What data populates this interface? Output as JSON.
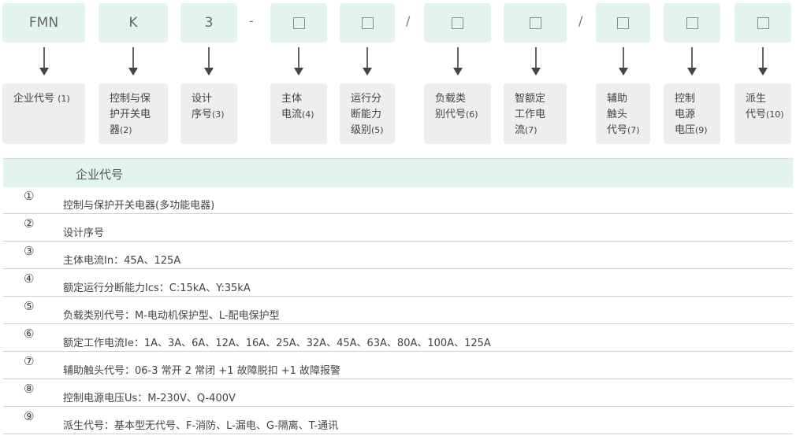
{
  "codes": [
    {
      "text": "FMN",
      "placeholder": false
    },
    {
      "text": "K",
      "placeholder": false
    },
    {
      "text": "3",
      "placeholder": false
    },
    {
      "text": "",
      "placeholder": true
    },
    {
      "text": "",
      "placeholder": true
    },
    {
      "text": "",
      "placeholder": true
    },
    {
      "text": "",
      "placeholder": true
    },
    {
      "text": "",
      "placeholder": true
    },
    {
      "text": "",
      "placeholder": true
    },
    {
      "text": "",
      "placeholder": true
    }
  ],
  "separators": [
    "-",
    "/",
    "/"
  ],
  "descriptions": [
    {
      "lines": [
        {
          "text": "企业代号",
          "num": "(1)"
        }
      ]
    },
    {
      "lines": [
        {
          "text": "控制与保"
        },
        {
          "text": "护开关电"
        },
        {
          "text": "器",
          "num": "(2)"
        }
      ]
    },
    {
      "lines": [
        {
          "text": "设计"
        },
        {
          "text": "序号",
          "num": "(3)"
        }
      ]
    },
    {
      "lines": [
        {
          "text": "主体"
        },
        {
          "text": "电流",
          "num": "(4)"
        }
      ]
    },
    {
      "lines": [
        {
          "text": "运行分"
        },
        {
          "text": "断能力"
        },
        {
          "text": "级别",
          "num": "(5)"
        }
      ]
    },
    {
      "lines": [
        {
          "text": "负载类"
        },
        {
          "text": "别代号",
          "num": "(6)"
        }
      ]
    },
    {
      "lines": [
        {
          "text": "智额定"
        },
        {
          "text": "工作电"
        },
        {
          "text": "流",
          "num": "(7)"
        }
      ]
    },
    {
      "lines": [
        {
          "text": "辅助"
        },
        {
          "text": "触头"
        },
        {
          "text": "代号",
          "num": "(7)"
        }
      ]
    },
    {
      "lines": [
        {
          "text": "控制"
        },
        {
          "text": "电源"
        },
        {
          "text": "电压",
          "num": "(9)"
        }
      ]
    },
    {
      "lines": [
        {
          "text": "派生"
        },
        {
          "text": "代号",
          "num": "(10)"
        }
      ]
    }
  ],
  "table": {
    "header": "企业代号",
    "rows": [
      {
        "marker": "①",
        "text": "控制与保护开关电器(多功能电器)"
      },
      {
        "marker": "②",
        "text": "设计序号"
      },
      {
        "marker": "③",
        "text": "主体电流In：45A、125A"
      },
      {
        "marker": "④",
        "text": "额定运行分断能力Ics：C:15kA、Y:35kA"
      },
      {
        "marker": "⑤",
        "text": "负载类别代号：M-电动机保护型、L-配电保护型"
      },
      {
        "marker": "⑥",
        "text": "额定工作电流Ie：1A、3A、6A、12A、16A、25A、32A、45A、63A、80A、100A、125A"
      },
      {
        "marker": "⑦",
        "text": "辅助触头代号：06-3 常开 2 常闭 +1 故障脱扣 +1 故障报警"
      },
      {
        "marker": "⑧",
        "text": "控制电源电压Us：M-230V、Q-400V"
      },
      {
        "marker": "⑨",
        "text": "派生代号：基本型无代号、F-消防、L-漏电、G-隔离、T-通讯"
      }
    ]
  },
  "colors": {
    "code_box_bg": "#e3f3ef",
    "desc_box_bg": "#eeeeee",
    "header_bg": "#e3f3ef"
  }
}
